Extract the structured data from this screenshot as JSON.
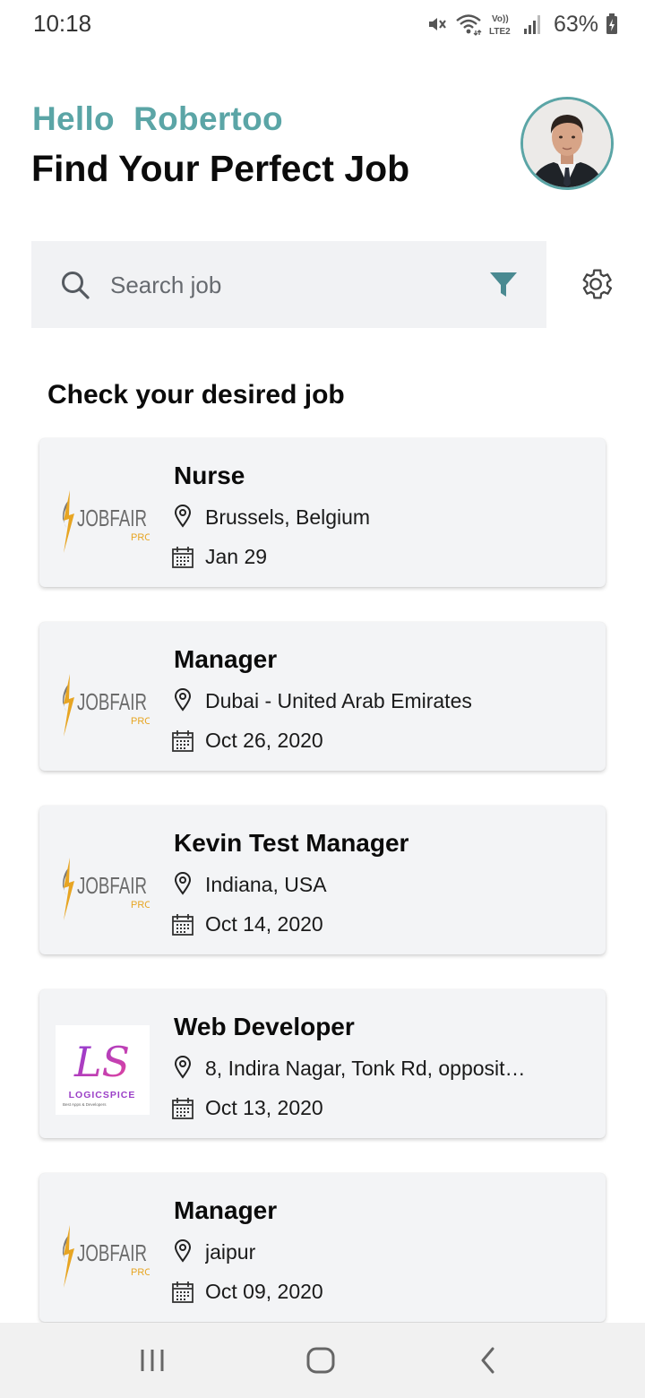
{
  "status_bar": {
    "time": "10:18",
    "network_label": "Vo)) LTE2",
    "battery_percent": "63%",
    "icons": [
      "mute-icon",
      "wifi-icon",
      "lte-icon",
      "signal-icon",
      "battery-icon"
    ]
  },
  "header": {
    "greeting": "Hello  Robertoo",
    "headline": "Find Your Perfect Job",
    "avatar": "avatar"
  },
  "search": {
    "placeholder": "Search job",
    "filter_icon": "filter-icon",
    "settings_icon": "gear-icon"
  },
  "section_title": "Check your desired job",
  "jobs": [
    {
      "title": "Nurse",
      "location": "Brussels, Belgium",
      "date": "Jan 29",
      "logo": "jobfair"
    },
    {
      "title": "Manager",
      "location": "Dubai - United Arab Emirates",
      "date": "Oct 26, 2020",
      "logo": "jobfair"
    },
    {
      "title": "Kevin Test Manager",
      "location": "Indiana, USA",
      "date": "Oct 14, 2020",
      "logo": "jobfair"
    },
    {
      "title": "Web Developer",
      "location": "8, Indira Nagar, Tonk Rd, opposit…",
      "date": "Oct 13, 2020",
      "logo": "logicspice"
    },
    {
      "title": "Manager",
      "location": "jaipur",
      "date": "Oct 09, 2020",
      "logo": "jobfair"
    }
  ],
  "logos": {
    "jobfair_text": "JOBFAIR",
    "jobfair_sub": "PRO",
    "logicspice_mark": "LS",
    "logicspice_text": "LOGICSPICE",
    "logicspice_tagline": "Best Apps & Developers"
  },
  "colors": {
    "accent": "#5ba5a6",
    "search_bg": "#f1f2f4",
    "card_bg": "#f3f4f6",
    "filter": "#4a8a91"
  }
}
